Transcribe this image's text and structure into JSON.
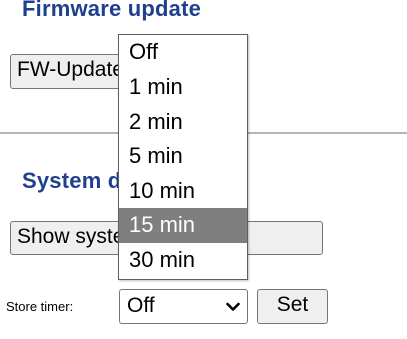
{
  "firmware": {
    "heading": "Firmware update",
    "button_label": "FW-Update"
  },
  "system": {
    "heading": "System diagnosis",
    "button_label": "Show system diagnosis"
  },
  "store_timer": {
    "label": "Store timer:",
    "selected": "Off",
    "set_label": "Set",
    "options": [
      "Off",
      "1 min",
      "2 min",
      "5 min",
      "10 min",
      "15 min",
      "30 min"
    ],
    "highlighted_option": "15 min"
  },
  "colors": {
    "heading": "#1f3f8f",
    "highlight_bg": "#7f7f7f"
  }
}
